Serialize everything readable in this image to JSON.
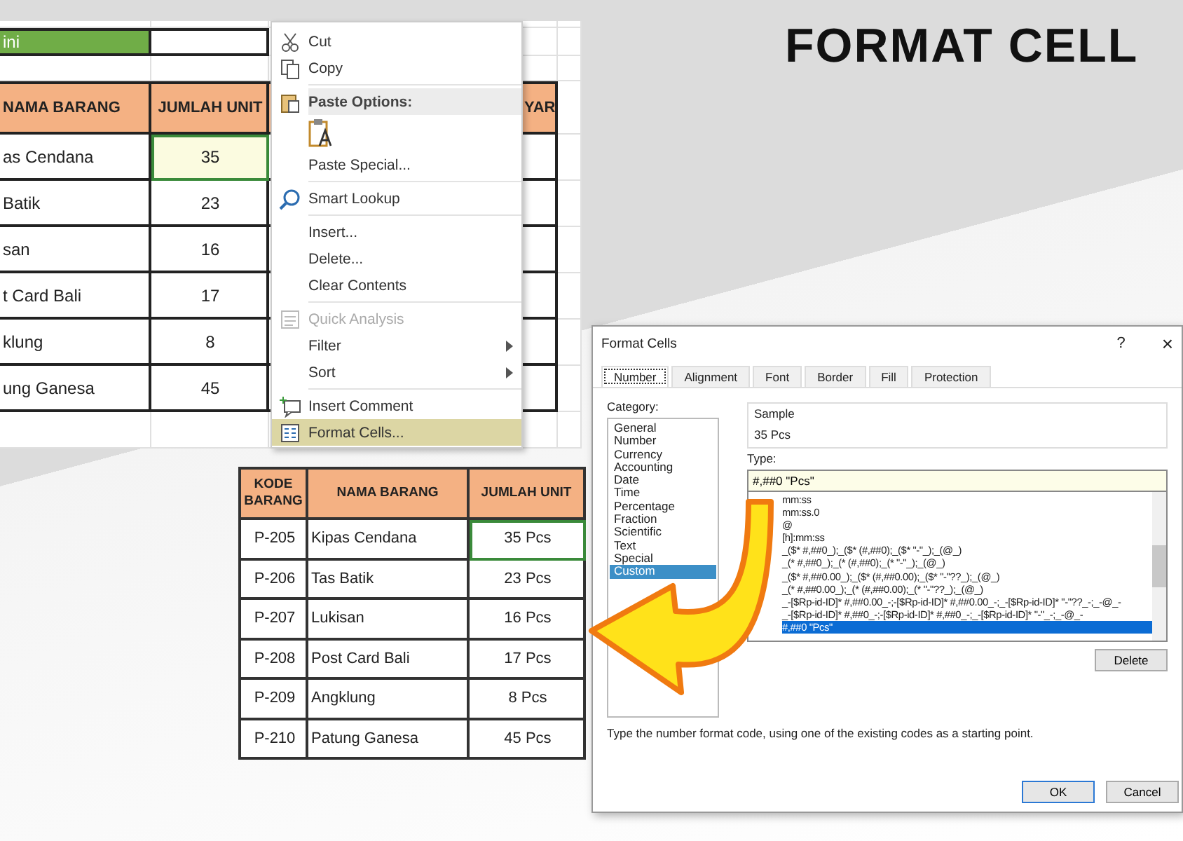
{
  "title": "FORMAT CELL",
  "sheet_top": {
    "label_cell": "ini",
    "headers": {
      "nama": "NAMA BARANG",
      "jumlah": "JUMLAH UNIT",
      "column_4": "YAR"
    },
    "rows": [
      {
        "name": "as Cendana",
        "units": "35",
        "selected": true
      },
      {
        "name": "Batik",
        "units": "23",
        "selected": false
      },
      {
        "name": "san",
        "units": "16",
        "selected": false
      },
      {
        "name": "t Card Bali",
        "units": "17",
        "selected": false
      },
      {
        "name": "klung",
        "units": "8",
        "selected": false
      },
      {
        "name": "ung Ganesa",
        "units": "45",
        "selected": false
      }
    ]
  },
  "context_menu": {
    "items": [
      {
        "kind": "item",
        "label": "Cut",
        "disabled": false,
        "selected": false
      },
      {
        "kind": "item",
        "label": "Copy",
        "disabled": false,
        "selected": false
      },
      {
        "kind": "header",
        "label": "Paste Options:"
      },
      {
        "kind": "paste_option"
      },
      {
        "kind": "item",
        "label": "Paste Special...",
        "disabled": false,
        "selected": false
      },
      {
        "kind": "item",
        "label": "Smart Lookup",
        "disabled": false,
        "selected": false
      },
      {
        "kind": "item",
        "label": "Insert...",
        "disabled": false,
        "selected": false
      },
      {
        "kind": "item",
        "label": "Delete...",
        "disabled": false,
        "selected": false
      },
      {
        "kind": "item",
        "label": "Clear Contents",
        "disabled": false,
        "selected": false
      },
      {
        "kind": "item",
        "label": "Quick Analysis",
        "disabled": true,
        "selected": false
      },
      {
        "kind": "submenu",
        "label": "Filter",
        "disabled": false,
        "selected": false
      },
      {
        "kind": "submenu",
        "label": "Sort",
        "disabled": false,
        "selected": false
      },
      {
        "kind": "item",
        "label": "Insert Comment",
        "disabled": false,
        "selected": false
      },
      {
        "kind": "item",
        "label": "Format Cells...",
        "disabled": false,
        "selected": true
      }
    ]
  },
  "sheet_bottom": {
    "columns": [
      "KODE BARANG",
      "NAMA BARANG",
      "JUMLAH UNIT"
    ],
    "rows": [
      {
        "code": "P-205",
        "name": "Kipas Cendana",
        "units": "35 Pcs",
        "selected": true
      },
      {
        "code": "P-206",
        "name": "Tas Batik",
        "units": "23 Pcs",
        "selected": false
      },
      {
        "code": "P-207",
        "name": "Lukisan",
        "units": "16 Pcs",
        "selected": false
      },
      {
        "code": "P-208",
        "name": "Post Card Bali",
        "units": "17 Pcs",
        "selected": false
      },
      {
        "code": "P-209",
        "name": "Angklung",
        "units": "8 Pcs",
        "selected": false
      },
      {
        "code": "P-210",
        "name": "Patung Ganesa",
        "units": "45 Pcs",
        "selected": false
      }
    ]
  },
  "dialog": {
    "title": "Format Cells",
    "help": "?",
    "close": "×",
    "tabs": [
      {
        "label": "Number",
        "selected": true
      },
      {
        "label": "Alignment",
        "selected": false
      },
      {
        "label": "Font",
        "selected": false
      },
      {
        "label": "Border",
        "selected": false
      },
      {
        "label": "Fill",
        "selected": false
      },
      {
        "label": "Protection",
        "selected": false
      }
    ],
    "category_label": "Category:",
    "categories": [
      {
        "label": "General",
        "selected": false
      },
      {
        "label": "Number",
        "selected": false
      },
      {
        "label": "Currency",
        "selected": false
      },
      {
        "label": "Accounting",
        "selected": false
      },
      {
        "label": "Date",
        "selected": false
      },
      {
        "label": "Time",
        "selected": false
      },
      {
        "label": "Percentage",
        "selected": false
      },
      {
        "label": "Fraction",
        "selected": false
      },
      {
        "label": "Scientific",
        "selected": false
      },
      {
        "label": "Text",
        "selected": false
      },
      {
        "label": "Special",
        "selected": false
      },
      {
        "label": "Custom",
        "selected": true
      }
    ],
    "sample_label": "Sample",
    "sample": "35 Pcs",
    "type_label": "Type:",
    "type_value": "#,##0 \"Pcs\"",
    "types": [
      {
        "label": "mm:ss",
        "selected": false
      },
      {
        "label": "mm:ss.0",
        "selected": false
      },
      {
        "label": "@",
        "selected": false
      },
      {
        "label": "[h]:mm:ss",
        "selected": false
      },
      {
        "label": "_($* #,##0_);_($* (#,##0);_($* \"-\"_);_(@_)",
        "selected": false
      },
      {
        "label": "_(* #,##0_);_(* (#,##0);_(* \"-\"_);_(@_)",
        "selected": false
      },
      {
        "label": "_($* #,##0.00_);_($* (#,##0.00);_($* \"-\"??_);_(@_)",
        "selected": false
      },
      {
        "label": "_(* #,##0.00_);_(* (#,##0.00);_(* \"-\"??_);_(@_)",
        "selected": false
      },
      {
        "label": "_-[$Rp-id-ID]* #,##0.00_-;-[$Rp-id-ID]* #,##0.00_-;_-[$Rp-id-ID]* \"-\"??_-;_-@_-",
        "selected": false
      },
      {
        "label": "_-[$Rp-id-ID]* #,##0_-;-[$Rp-id-ID]* #,##0_-;_-[$Rp-id-ID]* \"-\"_-;_-@_-",
        "selected": false
      },
      {
        "label": "#,##0 \"Pcs\"",
        "selected": true
      }
    ],
    "delete": "Delete",
    "hint": "Type the number format code, using one of the existing codes as a starting point.",
    "ok": "OK",
    "cancel": "Cancel"
  }
}
